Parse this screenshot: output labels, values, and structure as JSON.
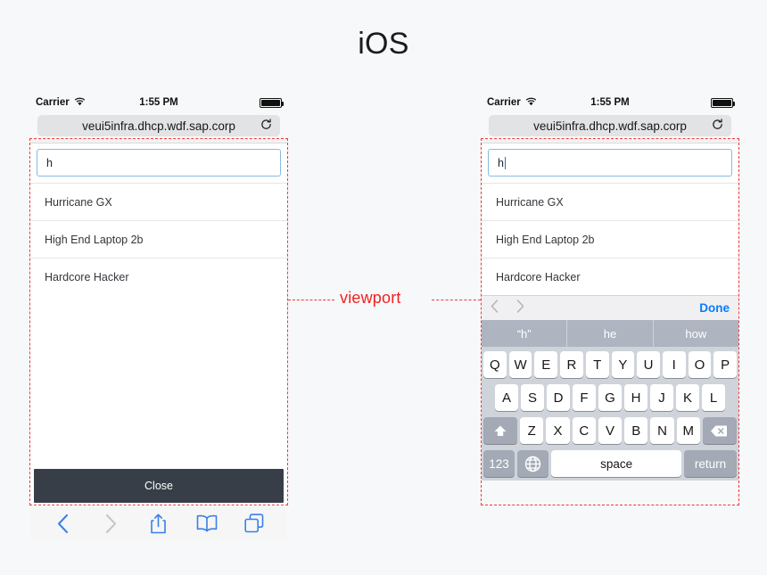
{
  "page": {
    "title": "iOS",
    "background": "#f7f8f9",
    "annotation_color": "#ef3a3a"
  },
  "annotation": {
    "viewport_label": "viewport"
  },
  "status_bar": {
    "carrier": "Carrier",
    "wifi_icon": "wifi-icon",
    "time": "1:55 PM",
    "battery_icon": "battery-icon"
  },
  "url_bar": {
    "url": "veui5infra.dhcp.wdf.sap.corp",
    "reload_icon": "reload-icon"
  },
  "web_content": {
    "search_value": "h",
    "search_placeholder": "",
    "suggestions": [
      "Hurricane GX",
      "High End Laptop 2b",
      "Hardcore Hacker"
    ],
    "close_label": "Close"
  },
  "safari_toolbar": {
    "items": [
      {
        "name": "back-icon",
        "label": "Back",
        "enabled": true
      },
      {
        "name": "forward-icon",
        "label": "Forward",
        "enabled": false
      },
      {
        "name": "share-icon",
        "label": "Share",
        "enabled": true
      },
      {
        "name": "bookmarks-icon",
        "label": "Bookmarks",
        "enabled": true
      },
      {
        "name": "tabs-icon",
        "label": "Tabs",
        "enabled": true
      }
    ],
    "accent_color": "#3b7fe8",
    "disabled_color": "#c3c5c8"
  },
  "keyboard": {
    "accessory": {
      "prev_icon": "chevron-left-icon",
      "next_icon": "chevron-right-icon",
      "done_label": "Done",
      "done_color": "#0b7bfb"
    },
    "predictions": [
      "“h”",
      "he",
      "how"
    ],
    "row1": [
      "Q",
      "W",
      "E",
      "R",
      "T",
      "Y",
      "U",
      "I",
      "O",
      "P"
    ],
    "row2": [
      "A",
      "S",
      "D",
      "F",
      "G",
      "H",
      "J",
      "K",
      "L"
    ],
    "row3": [
      "Z",
      "X",
      "C",
      "V",
      "B",
      "N",
      "M"
    ],
    "shift_icon": "shift-icon",
    "backspace_icon": "backspace-icon",
    "numbers_label": "123",
    "globe_icon": "globe-icon",
    "space_label": "space",
    "return_label": "return"
  }
}
